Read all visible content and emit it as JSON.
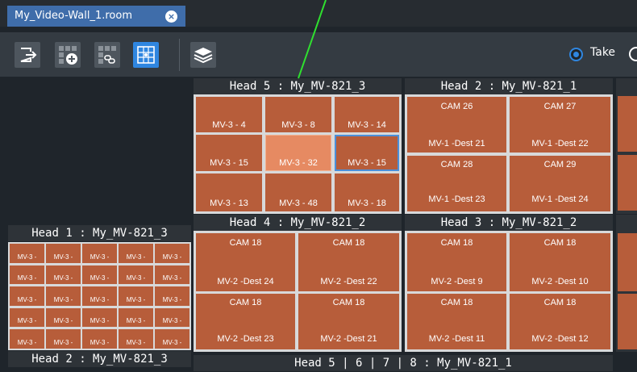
{
  "tab": {
    "title": "My_Video-Wall_1.room",
    "close_glyph": "×"
  },
  "toolbar": {
    "buttons": [
      {
        "name": "exit-icon"
      },
      {
        "name": "add-grid-icon"
      },
      {
        "name": "link-grid-icon"
      },
      {
        "name": "layout-grid-icon"
      },
      {
        "name": "layers-icon"
      }
    ],
    "take_label": "Take"
  },
  "heads": {
    "head5": {
      "title": "Head 5 : My_MV-821_3",
      "tiles": [
        "MV-3 - 4",
        "MV-3 - 8",
        "MV-3 - 14",
        "MV-3 - 15",
        "MV-3 - 32",
        "MV-3 - 15",
        "MV-3 - 13",
        "MV-3 - 48",
        "MV-3 - 18"
      ]
    },
    "head2a": {
      "title": "Head 2 : My_MV-821_1",
      "tiles": [
        {
          "top": "CAM 26",
          "bottom": "MV-1 -Dest 21"
        },
        {
          "top": "CAM 27",
          "bottom": "MV-1 -Dest 22"
        },
        {
          "top": "CAM 28",
          "bottom": "MV-1 -Dest 23"
        },
        {
          "top": "CAM 29",
          "bottom": "MV-1 -Dest 24"
        }
      ]
    },
    "head4": {
      "title": "Head 4 : My_MV-821_2",
      "tiles": [
        {
          "top": "CAM 18",
          "bottom": "MV-2 -Dest 24"
        },
        {
          "top": "CAM 18",
          "bottom": "MV-2 -Dest 22"
        },
        {
          "top": "CAM 18",
          "bottom": "MV-2 -Dest 23"
        },
        {
          "top": "CAM 18",
          "bottom": "MV-2 -Dest 21"
        }
      ]
    },
    "head3": {
      "title": "Head 3 : My_MV-821_2",
      "tiles": [
        {
          "top": "CAM 18",
          "bottom": "MV-2 -Dest 9"
        },
        {
          "top": "CAM 18",
          "bottom": "MV-2 -Dest 10"
        },
        {
          "top": "CAM 18",
          "bottom": "MV-2 -Dest 11"
        },
        {
          "top": "CAM 18",
          "bottom": "MV-2 -Dest 12"
        }
      ]
    },
    "head1": {
      "title": "Head 1 : My_MV-821_3",
      "mini_label": "MV-3 -"
    },
    "head2b": {
      "title": "Head 2 : My_MV-821_3"
    },
    "head5678": {
      "title": "Head 5 | 6 | 7 | 8 : My_MV-821_1"
    }
  },
  "colors": {
    "tile": "#b75d3a",
    "tile_selected": "#e68a62",
    "accent": "#2f86e0",
    "pointer": "#2fe02f"
  }
}
